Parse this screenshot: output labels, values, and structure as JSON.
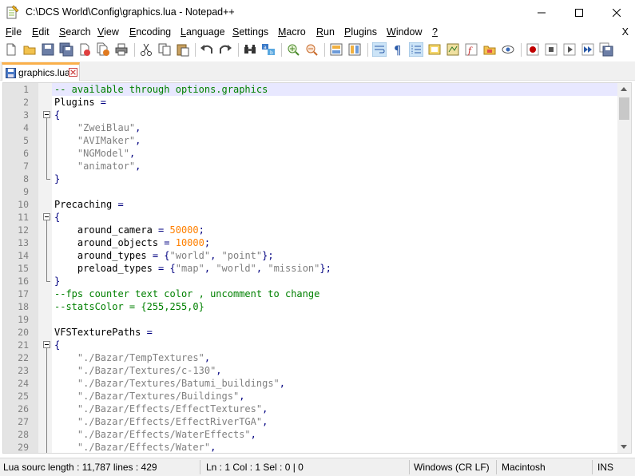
{
  "window": {
    "title": "C:\\DCS World\\Config\\graphics.lua - Notepad++"
  },
  "menu": {
    "items": [
      {
        "label": "File",
        "u": "F",
        "rest": "ile"
      },
      {
        "label": "Edit",
        "u": "E",
        "rest": "dit"
      },
      {
        "label": "Search",
        "u": "S",
        "rest": "earch"
      },
      {
        "label": "View",
        "u": "V",
        "rest": "iew"
      },
      {
        "label": "Encoding",
        "u": "E",
        "rest": "ncoding"
      },
      {
        "label": "Language",
        "u": "L",
        "rest": "anguage"
      },
      {
        "label": "Settings",
        "u": "S",
        "rest": "ettings"
      },
      {
        "label": "Macro",
        "u": "M",
        "rest": "acro"
      },
      {
        "label": "Run",
        "u": "R",
        "rest": "un"
      },
      {
        "label": "Plugins",
        "u": "P",
        "rest": "lugins"
      },
      {
        "label": "Window",
        "u": "W",
        "rest": "indow"
      },
      {
        "label": "?",
        "u": "?",
        "rest": ""
      }
    ],
    "close_label": "X"
  },
  "tab": {
    "label": "graphics.lua"
  },
  "editor": {
    "lines": [
      {
        "n": "1",
        "t": [
          [
            "c-comment",
            "-- available through options.graphics"
          ]
        ]
      },
      {
        "n": "2",
        "t": [
          [
            "c-id",
            "Plugins "
          ],
          [
            "c-op",
            "="
          ]
        ]
      },
      {
        "n": "3",
        "t": [
          [
            "c-op",
            "{"
          ]
        ]
      },
      {
        "n": "4",
        "t": [
          [
            "c-id",
            "    "
          ],
          [
            "c-str",
            "\"ZweiBlau\""
          ],
          [
            "c-op",
            ","
          ]
        ]
      },
      {
        "n": "5",
        "t": [
          [
            "c-id",
            "    "
          ],
          [
            "c-str",
            "\"AVIMaker\""
          ],
          [
            "c-op",
            ","
          ]
        ]
      },
      {
        "n": "6",
        "t": [
          [
            "c-id",
            "    "
          ],
          [
            "c-str",
            "\"NGModel\""
          ],
          [
            "c-op",
            ","
          ]
        ]
      },
      {
        "n": "7",
        "t": [
          [
            "c-id",
            "    "
          ],
          [
            "c-str",
            "\"animator\""
          ],
          [
            "c-op",
            ","
          ]
        ]
      },
      {
        "n": "8",
        "t": [
          [
            "c-op",
            "}"
          ]
        ]
      },
      {
        "n": "9",
        "t": []
      },
      {
        "n": "10",
        "t": [
          [
            "c-id",
            "Precaching "
          ],
          [
            "c-op",
            "="
          ]
        ]
      },
      {
        "n": "11",
        "t": [
          [
            "c-op",
            "{"
          ]
        ]
      },
      {
        "n": "12",
        "t": [
          [
            "c-id",
            "    around_camera "
          ],
          [
            "c-op",
            "= "
          ],
          [
            "c-num",
            "50000"
          ],
          [
            "c-op",
            ";"
          ]
        ]
      },
      {
        "n": "13",
        "t": [
          [
            "c-id",
            "    around_objects "
          ],
          [
            "c-op",
            "= "
          ],
          [
            "c-num",
            "10000"
          ],
          [
            "c-op",
            ";"
          ]
        ]
      },
      {
        "n": "14",
        "t": [
          [
            "c-id",
            "    around_types "
          ],
          [
            "c-op",
            "= {"
          ],
          [
            "c-str",
            "\"world\""
          ],
          [
            "c-op",
            ", "
          ],
          [
            "c-str",
            "\"point\""
          ],
          [
            "c-op",
            "};"
          ]
        ]
      },
      {
        "n": "15",
        "t": [
          [
            "c-id",
            "    preload_types "
          ],
          [
            "c-op",
            "= {"
          ],
          [
            "c-str",
            "\"map\""
          ],
          [
            "c-op",
            ", "
          ],
          [
            "c-str",
            "\"world\""
          ],
          [
            "c-op",
            ", "
          ],
          [
            "c-str",
            "\"mission\""
          ],
          [
            "c-op",
            "};"
          ]
        ]
      },
      {
        "n": "16",
        "t": [
          [
            "c-op",
            "}"
          ]
        ]
      },
      {
        "n": "17",
        "t": [
          [
            "c-comment",
            "--fps counter text color , uncomment to change"
          ]
        ]
      },
      {
        "n": "18",
        "t": [
          [
            "c-comment",
            "--statsColor = {255,255,0}"
          ]
        ]
      },
      {
        "n": "19",
        "t": []
      },
      {
        "n": "20",
        "t": [
          [
            "c-id",
            "VFSTexturePaths "
          ],
          [
            "c-op",
            "="
          ]
        ]
      },
      {
        "n": "21",
        "t": [
          [
            "c-op",
            "{"
          ]
        ]
      },
      {
        "n": "22",
        "t": [
          [
            "c-id",
            "    "
          ],
          [
            "c-str",
            "\"./Bazar/TempTextures\""
          ],
          [
            "c-op",
            ","
          ]
        ]
      },
      {
        "n": "23",
        "t": [
          [
            "c-id",
            "    "
          ],
          [
            "c-str",
            "\"./Bazar/Textures/c-130\""
          ],
          [
            "c-op",
            ","
          ]
        ]
      },
      {
        "n": "24",
        "t": [
          [
            "c-id",
            "    "
          ],
          [
            "c-str",
            "\"./Bazar/Textures/Batumi_buildings\""
          ],
          [
            "c-op",
            ","
          ]
        ]
      },
      {
        "n": "25",
        "t": [
          [
            "c-id",
            "    "
          ],
          [
            "c-str",
            "\"./Bazar/Textures/Buildings\""
          ],
          [
            "c-op",
            ","
          ]
        ]
      },
      {
        "n": "26",
        "t": [
          [
            "c-id",
            "    "
          ],
          [
            "c-str",
            "\"./Bazar/Effects/EffectTextures\""
          ],
          [
            "c-op",
            ","
          ]
        ]
      },
      {
        "n": "27",
        "t": [
          [
            "c-id",
            "    "
          ],
          [
            "c-str",
            "\"./Bazar/Effects/EffectRiverTGA\""
          ],
          [
            "c-op",
            ","
          ]
        ]
      },
      {
        "n": "28",
        "t": [
          [
            "c-id",
            "    "
          ],
          [
            "c-str",
            "\"./Bazar/Effects/WaterEffects\""
          ],
          [
            "c-op",
            ","
          ]
        ]
      },
      {
        "n": "29",
        "t": [
          [
            "c-id",
            "    "
          ],
          [
            "c-str",
            "\"./Bazar/Effects/Water\""
          ],
          [
            "c-op",
            ","
          ]
        ]
      }
    ]
  },
  "status": {
    "type": "Lua sourc length : 11,787    lines : 429",
    "pos": "Ln : 1    Col : 1    Sel : 0 | 0",
    "eol": "Windows (CR LF)",
    "encoding": "Macintosh",
    "mode": "INS"
  }
}
